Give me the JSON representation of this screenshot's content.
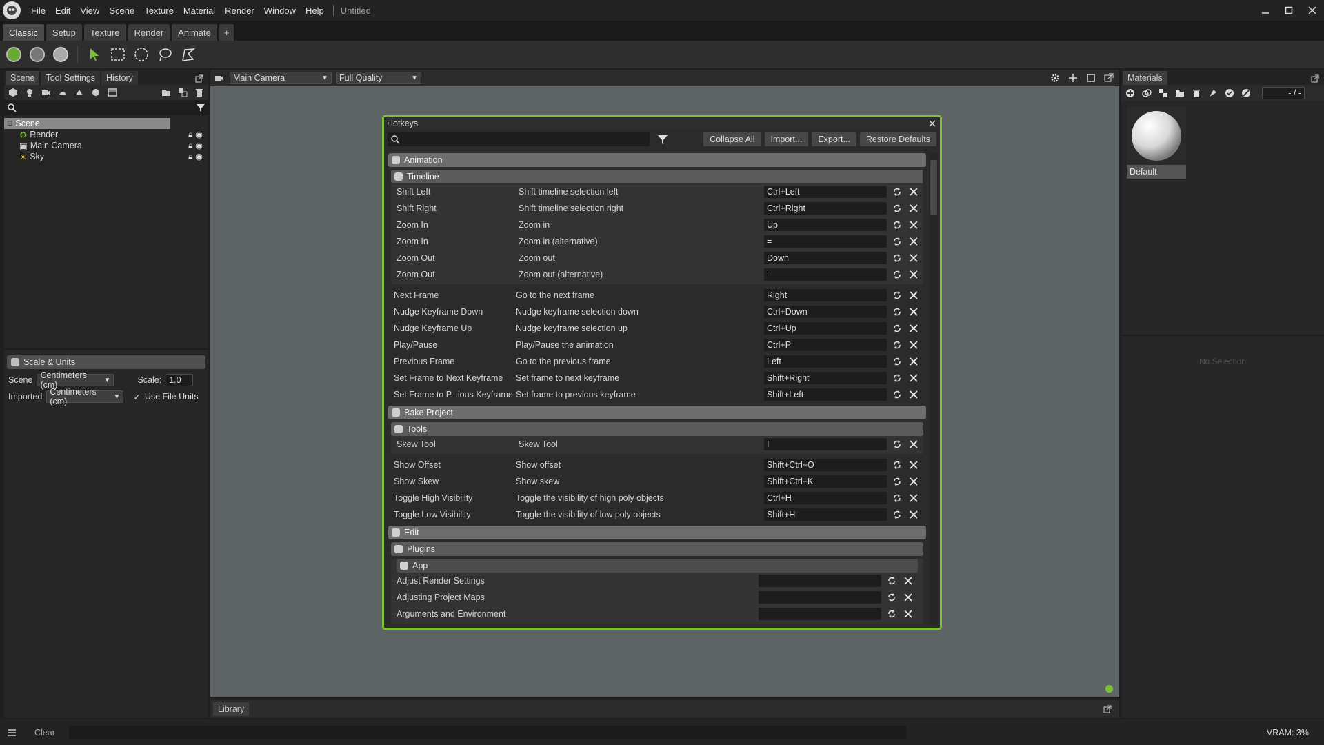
{
  "menubar": {
    "items": [
      "File",
      "Edit",
      "View",
      "Scene",
      "Texture",
      "Material",
      "Render",
      "Window",
      "Help"
    ],
    "doc_title": "Untitled"
  },
  "workspace_tabs": [
    "Classic",
    "Setup",
    "Texture",
    "Render",
    "Animate",
    "+"
  ],
  "left_panel": {
    "tabs": [
      "Scene",
      "Tool Settings",
      "History"
    ],
    "tree": [
      {
        "label": "Scene",
        "icon": "scene-icon"
      },
      {
        "label": "Render",
        "icon": "render-icon"
      },
      {
        "label": "Main Camera",
        "icon": "camera-icon"
      },
      {
        "label": "Sky",
        "icon": "sky-icon"
      }
    ],
    "scale_units": {
      "title": "Scale & Units",
      "scene_label": "Scene",
      "scene_value": "Centimeters (cm)",
      "scale_label": "Scale:",
      "scale_value": "1.0",
      "imported_label": "Imported",
      "imported_value": "Centimeters (cm)",
      "use_file_units": "Use File Units"
    }
  },
  "viewport": {
    "camera": "Main Camera",
    "quality": "Full Quality"
  },
  "right_panel": {
    "tab": "Materials",
    "counter": "- / -",
    "material_name": "Default",
    "no_selection": "No Selection"
  },
  "library": {
    "label": "Library"
  },
  "status": {
    "clear": "Clear",
    "vram": "VRAM: 3%"
  },
  "hotkeys": {
    "title": "Hotkeys",
    "buttons": {
      "collapse_all": "Collapse All",
      "import": "Import...",
      "export": "Export...",
      "restore_defaults": "Restore Defaults"
    },
    "animation": {
      "title": "Animation",
      "timeline": {
        "title": "Timeline",
        "rows": [
          {
            "name": "Shift Left",
            "desc": "Shift timeline selection left",
            "key": "Ctrl+Left"
          },
          {
            "name": "Shift Right",
            "desc": "Shift timeline selection right",
            "key": "Ctrl+Right"
          },
          {
            "name": "Zoom In",
            "desc": "Zoom in",
            "key": "Up"
          },
          {
            "name": "Zoom In",
            "desc": "Zoom in (alternative)",
            "key": "="
          },
          {
            "name": "Zoom Out",
            "desc": "Zoom out",
            "key": "Down"
          },
          {
            "name": "Zoom Out",
            "desc": "Zoom out (alternative)",
            "key": "-"
          }
        ]
      },
      "rows": [
        {
          "name": "Next Frame",
          "desc": "Go to the next frame",
          "key": "Right"
        },
        {
          "name": "Nudge Keyframe Down",
          "desc": "Nudge keyframe selection down",
          "key": "Ctrl+Down"
        },
        {
          "name": "Nudge Keyframe Up",
          "desc": "Nudge keyframe selection up",
          "key": "Ctrl+Up"
        },
        {
          "name": "Play/Pause",
          "desc": "Play/Pause the animation",
          "key": "Ctrl+P"
        },
        {
          "name": "Previous Frame",
          "desc": "Go to the previous frame",
          "key": "Left"
        },
        {
          "name": "Set Frame to Next Keyframe",
          "desc": "Set frame to next keyframe",
          "key": "Shift+Right"
        },
        {
          "name": "Set Frame to P...ious Keyframe",
          "desc": "Set frame to previous keyframe",
          "key": "Shift+Left"
        }
      ]
    },
    "bake": {
      "title": "Bake Project",
      "tools": {
        "title": "Tools",
        "rows": [
          {
            "name": "Skew Tool",
            "desc": "Skew Tool",
            "key": "I"
          }
        ]
      },
      "rows": [
        {
          "name": "Show Offset",
          "desc": "Show offset",
          "key": "Shift+Ctrl+O"
        },
        {
          "name": "Show Skew",
          "desc": "Show skew",
          "key": "Shift+Ctrl+K"
        },
        {
          "name": "Toggle High Visibility",
          "desc": "Toggle the visibility of high poly objects",
          "key": "Ctrl+H"
        },
        {
          "name": "Toggle Low Visibility",
          "desc": "Toggle the visibility of low poly objects",
          "key": "Shift+H"
        }
      ]
    },
    "edit": {
      "title": "Edit",
      "plugins": {
        "title": "Plugins",
        "app": {
          "title": "App",
          "rows": [
            {
              "name": "Adjust Render Settings",
              "desc": "",
              "key": ""
            },
            {
              "name": "Adjusting Project Maps",
              "desc": "",
              "key": ""
            },
            {
              "name": "Arguments and Environment",
              "desc": "",
              "key": ""
            }
          ]
        }
      }
    }
  },
  "colors": {
    "accent": "#7dc235",
    "viewport": "#5e6366",
    "panel": "#262626"
  }
}
